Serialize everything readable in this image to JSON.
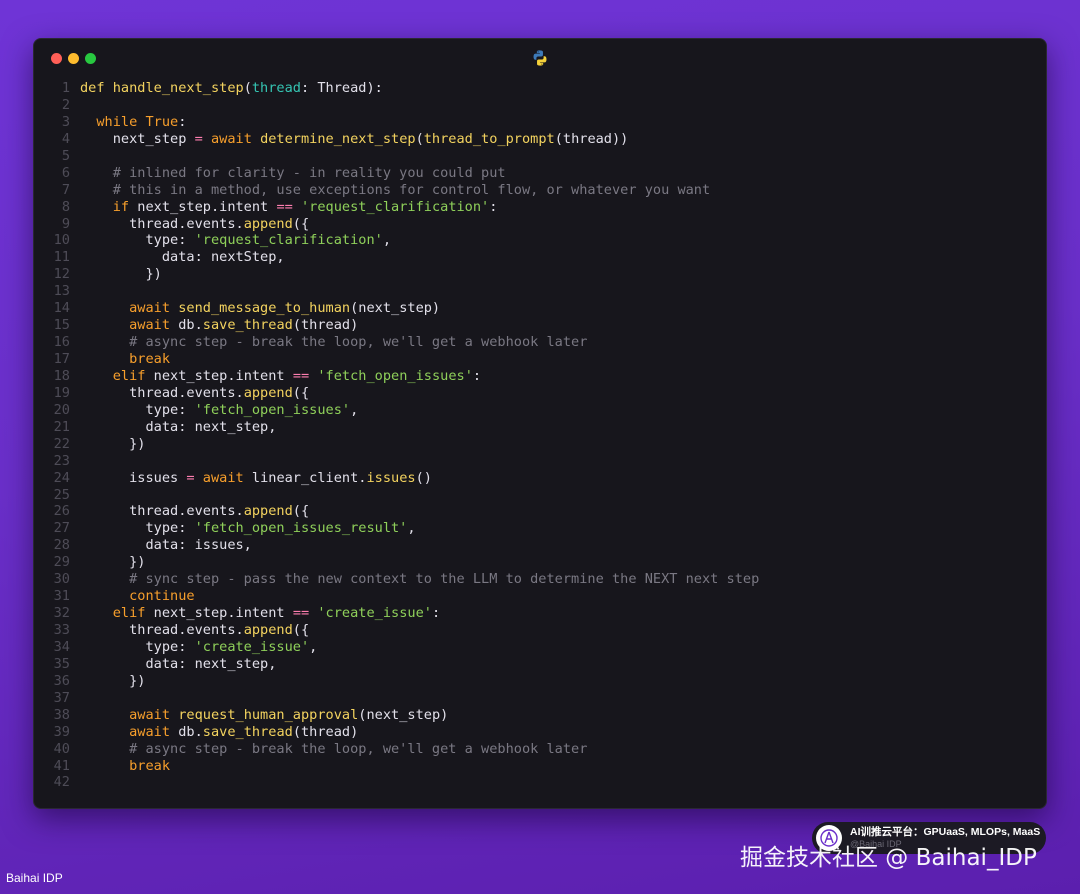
{
  "window": {
    "language_icon": "python-icon",
    "code_lines": [
      [
        [
          "fn",
          "def handle_next_step"
        ],
        [
          "plain",
          "("
        ],
        [
          "par",
          "thread"
        ],
        [
          "plain",
          ": Thread):"
        ]
      ],
      [],
      [
        [
          "kw",
          "  while True"
        ],
        [
          "plain",
          ":"
        ]
      ],
      [
        [
          "plain",
          "    next_step "
        ],
        [
          "op",
          "="
        ],
        [
          "plain",
          " "
        ],
        [
          "kw",
          "await"
        ],
        [
          "plain",
          " "
        ],
        [
          "fn",
          "determine_next_step"
        ],
        [
          "plain",
          "("
        ],
        [
          "fn",
          "thread_to_prompt"
        ],
        [
          "plain",
          "(thread))"
        ]
      ],
      [],
      [
        [
          "cm",
          "    # inlined for clarity - in reality you could put"
        ]
      ],
      [
        [
          "cm",
          "    # this in a method, use exceptions for control flow, or whatever you want"
        ]
      ],
      [
        [
          "kw",
          "    if"
        ],
        [
          "plain",
          " next_step.intent "
        ],
        [
          "op",
          "=="
        ],
        [
          "plain",
          " "
        ],
        [
          "str",
          "'request_clarification'"
        ],
        [
          "plain",
          ":"
        ]
      ],
      [
        [
          "plain",
          "      thread.events."
        ],
        [
          "fn",
          "append"
        ],
        [
          "plain",
          "({"
        ]
      ],
      [
        [
          "plain",
          "        type: "
        ],
        [
          "str",
          "'request_clarification'"
        ],
        [
          "plain",
          ","
        ]
      ],
      [
        [
          "plain",
          "          data: nextStep,"
        ]
      ],
      [
        [
          "plain",
          "        })"
        ]
      ],
      [],
      [
        [
          "kw",
          "      await"
        ],
        [
          "plain",
          " "
        ],
        [
          "fn",
          "send_message_to_human"
        ],
        [
          "plain",
          "(next_step)"
        ]
      ],
      [
        [
          "kw",
          "      await"
        ],
        [
          "plain",
          " db."
        ],
        [
          "fn",
          "save_thread"
        ],
        [
          "plain",
          "(thread)"
        ]
      ],
      [
        [
          "cm",
          "      # async step - break the loop, we'll get a webhook later"
        ]
      ],
      [
        [
          "kw",
          "      break"
        ]
      ],
      [
        [
          "kw",
          "    elif"
        ],
        [
          "plain",
          " next_step.intent "
        ],
        [
          "op",
          "=="
        ],
        [
          "plain",
          " "
        ],
        [
          "str",
          "'fetch_open_issues'"
        ],
        [
          "plain",
          ":"
        ]
      ],
      [
        [
          "plain",
          "      thread.events."
        ],
        [
          "fn",
          "append"
        ],
        [
          "plain",
          "({"
        ]
      ],
      [
        [
          "plain",
          "        type: "
        ],
        [
          "str",
          "'fetch_open_issues'"
        ],
        [
          "plain",
          ","
        ]
      ],
      [
        [
          "plain",
          "        data: next_step,"
        ]
      ],
      [
        [
          "plain",
          "      })"
        ]
      ],
      [],
      [
        [
          "plain",
          "      issues "
        ],
        [
          "op",
          "="
        ],
        [
          "plain",
          " "
        ],
        [
          "kw",
          "await"
        ],
        [
          "plain",
          " linear_client."
        ],
        [
          "fn",
          "issues"
        ],
        [
          "plain",
          "()"
        ]
      ],
      [],
      [
        [
          "plain",
          "      thread.events."
        ],
        [
          "fn",
          "append"
        ],
        [
          "plain",
          "({"
        ]
      ],
      [
        [
          "plain",
          "        type: "
        ],
        [
          "str",
          "'fetch_open_issues_result'"
        ],
        [
          "plain",
          ","
        ]
      ],
      [
        [
          "plain",
          "        data: issues,"
        ]
      ],
      [
        [
          "plain",
          "      })"
        ]
      ],
      [
        [
          "cm",
          "      # sync step - pass the new context to the LLM to determine the NEXT next step"
        ]
      ],
      [
        [
          "kw",
          "      continue"
        ]
      ],
      [
        [
          "kw",
          "    elif"
        ],
        [
          "plain",
          " next_step.intent "
        ],
        [
          "op",
          "=="
        ],
        [
          "plain",
          " "
        ],
        [
          "str",
          "'create_issue'"
        ],
        [
          "plain",
          ":"
        ]
      ],
      [
        [
          "plain",
          "      thread.events."
        ],
        [
          "fn",
          "append"
        ],
        [
          "plain",
          "({"
        ]
      ],
      [
        [
          "plain",
          "        type: "
        ],
        [
          "str",
          "'create_issue'"
        ],
        [
          "plain",
          ","
        ]
      ],
      [
        [
          "plain",
          "        data: next_step,"
        ]
      ],
      [
        [
          "plain",
          "      })"
        ]
      ],
      [],
      [
        [
          "kw",
          "      await"
        ],
        [
          "plain",
          " "
        ],
        [
          "fn",
          "request_human_approval"
        ],
        [
          "plain",
          "(next_step)"
        ]
      ],
      [
        [
          "kw",
          "      await"
        ],
        [
          "plain",
          " db."
        ],
        [
          "fn",
          "save_thread"
        ],
        [
          "plain",
          "(thread)"
        ]
      ],
      [
        [
          "cm",
          "      # async step - break the loop, we'll get a webhook later"
        ]
      ],
      [
        [
          "kw",
          "      break"
        ]
      ],
      []
    ]
  },
  "footer": {
    "left_label": "Baihai IDP",
    "watermark": "掘金技术社区 @ Baihai_IDP",
    "badge_title": "AI训推云平台：GPUaaS, MLOPs, MaaS",
    "badge_sub": "@Baihai IDP"
  }
}
